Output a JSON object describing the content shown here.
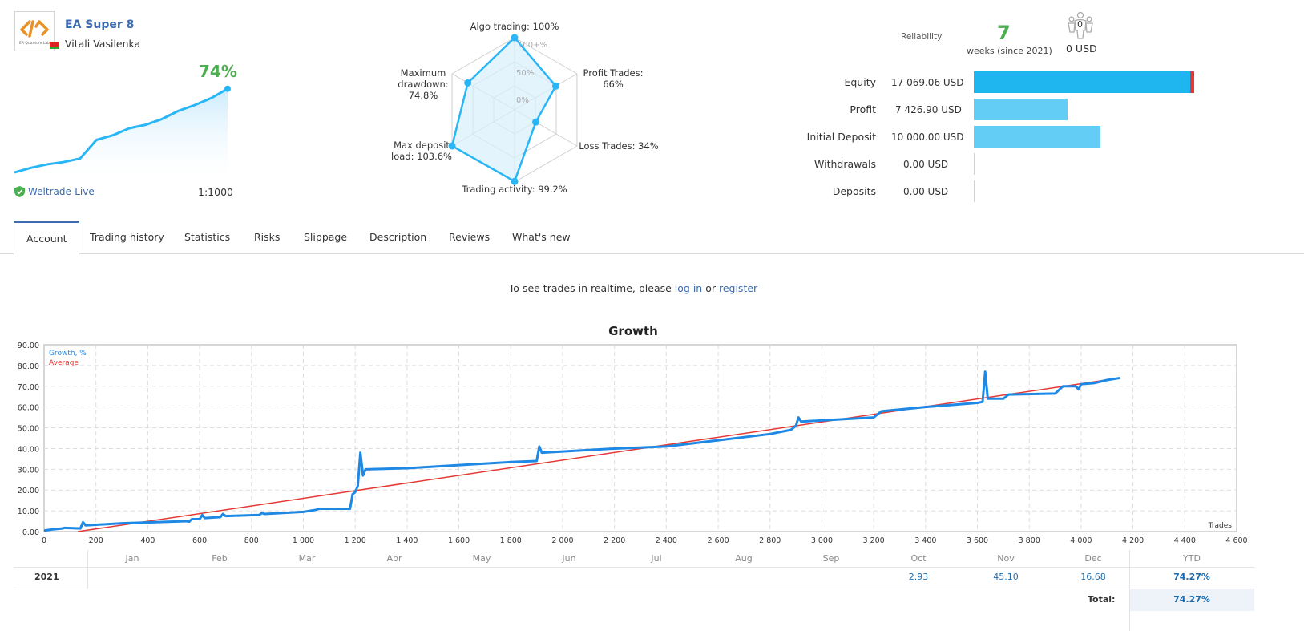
{
  "header": {
    "title": "EA Super 8",
    "author": "Vitali Vasilenka",
    "logo_text": "ER Quantum Lab",
    "growth_pct": "74%",
    "server": "Weltrade-Live",
    "leverage": "1:1000",
    "mini_chart_values": [
      2,
      6,
      9,
      11,
      14,
      30,
      34,
      40,
      43,
      48,
      55,
      60,
      66,
      74
    ]
  },
  "radar": {
    "axes": [
      {
        "label": "Algo trading: 100%",
        "value": 100
      },
      {
        "label": "Profit Trades:\n66%",
        "value": 66
      },
      {
        "label": "Loss Trades: 34%",
        "value": 34
      },
      {
        "label": "Trading activity: 99.2%",
        "value": 99.2
      },
      {
        "label": "Max deposit\nload: 103.6%",
        "value": 100
      },
      {
        "label": "Maximum\ndrawdown:\n74.8%",
        "value": 74.8
      }
    ],
    "scale_labels": [
      "100+%",
      "50%",
      "0%"
    ]
  },
  "stats": {
    "reliability_label": "Reliability",
    "weeks_value": "7",
    "weeks_label": "weeks (since 2021)",
    "subscribers_count": "0",
    "subscribers_usd": "0 USD",
    "rows": [
      {
        "label": "Equity",
        "value": "17 069.06 USD",
        "amount": 17069.06,
        "color": "#1fb5ef"
      },
      {
        "label": "Profit",
        "value": "7 426.90 USD",
        "amount": 7426.9,
        "color": "#64cdf5"
      },
      {
        "label": "Initial Deposit",
        "value": "10 000.00 USD",
        "amount": 10000.0,
        "color": "#64cdf5"
      },
      {
        "label": "Withdrawals",
        "value": "0.00 USD",
        "amount": 0,
        "color": "#a9dff5"
      },
      {
        "label": "Deposits",
        "value": "0.00 USD",
        "amount": 0,
        "color": "#a9dff5"
      }
    ]
  },
  "tabs": [
    {
      "label": "Account",
      "active": true
    },
    {
      "label": "Trading history"
    },
    {
      "label": "Statistics"
    },
    {
      "label": "Risks"
    },
    {
      "label": "Slippage"
    },
    {
      "label": "Description"
    },
    {
      "label": "Reviews"
    },
    {
      "label": "What's new"
    }
  ],
  "message": {
    "prefix": "To see trades in realtime, please ",
    "login": "log in",
    "middle": " or ",
    "register": "register"
  },
  "chart_data": {
    "type": "line",
    "title": "Growth",
    "xlabel": "Trades",
    "ylabel": "",
    "xlim": [
      0,
      4600
    ],
    "ylim": [
      0,
      90
    ],
    "grid": true,
    "legend_position": "top-left",
    "x_ticks": [
      "0",
      "200",
      "400",
      "600",
      "800",
      "1 000",
      "1 200",
      "1 400",
      "1 600",
      "1 800",
      "2 000",
      "2 200",
      "2 400",
      "2 600",
      "2 800",
      "3 000",
      "3 200",
      "3 400",
      "3 600",
      "3 800",
      "4 000",
      "4 200",
      "4 400",
      "4 600"
    ],
    "y_ticks": [
      "0.00",
      "10.00",
      "20.00",
      "30.00",
      "40.00",
      "50.00",
      "60.00",
      "70.00",
      "80.00",
      "90.00"
    ],
    "series": [
      {
        "name": "Growth, %",
        "color": "#1e88e5",
        "points": [
          [
            0,
            0.5
          ],
          [
            30,
            1
          ],
          [
            70,
            1.5
          ],
          [
            80,
            1.8
          ],
          [
            140,
            1.5
          ],
          [
            150,
            4.5
          ],
          [
            160,
            3
          ],
          [
            300,
            4
          ],
          [
            550,
            5
          ],
          [
            560,
            4.8
          ],
          [
            570,
            6
          ],
          [
            600,
            6
          ],
          [
            610,
            8
          ],
          [
            620,
            6.5
          ],
          [
            680,
            7
          ],
          [
            690,
            8.5
          ],
          [
            700,
            7.5
          ],
          [
            830,
            8
          ],
          [
            840,
            9
          ],
          [
            850,
            8.5
          ],
          [
            1000,
            9.5
          ],
          [
            1050,
            10.5
          ],
          [
            1060,
            11
          ],
          [
            1180,
            11
          ],
          [
            1190,
            18
          ],
          [
            1200,
            19
          ],
          [
            1210,
            22
          ],
          [
            1220,
            38
          ],
          [
            1230,
            27
          ],
          [
            1240,
            30
          ],
          [
            1400,
            30.5
          ],
          [
            1600,
            32
          ],
          [
            1800,
            33.5
          ],
          [
            1900,
            34
          ],
          [
            1910,
            41
          ],
          [
            1920,
            38
          ],
          [
            2200,
            40
          ],
          [
            2400,
            41
          ],
          [
            2600,
            44
          ],
          [
            2800,
            47
          ],
          [
            2880,
            49
          ],
          [
            2900,
            51
          ],
          [
            2910,
            55
          ],
          [
            2920,
            53
          ],
          [
            3200,
            55
          ],
          [
            3230,
            58
          ],
          [
            3400,
            60
          ],
          [
            3600,
            62
          ],
          [
            3620,
            62.5
          ],
          [
            3630,
            77
          ],
          [
            3640,
            64
          ],
          [
            3700,
            64
          ],
          [
            3720,
            66
          ],
          [
            3900,
            66.5
          ],
          [
            3930,
            70
          ],
          [
            3980,
            70
          ],
          [
            3990,
            68.5
          ],
          [
            4000,
            71
          ],
          [
            4050,
            71.5
          ],
          [
            4100,
            73
          ],
          [
            4150,
            74
          ]
        ]
      },
      {
        "name": "Average",
        "color": "#e53935",
        "points": [
          [
            130,
            0
          ],
          [
            4150,
            74
          ]
        ]
      }
    ],
    "monthly_table": {
      "months": [
        "Jan",
        "Feb",
        "Mar",
        "Apr",
        "May",
        "Jun",
        "Jul",
        "Aug",
        "Sep",
        "Oct",
        "Nov",
        "Dec"
      ],
      "ytd_label": "YTD",
      "rows": [
        {
          "year": "2021",
          "values": [
            "",
            "",
            "",
            "",
            "",
            "",
            "",
            "",
            "",
            "2.93",
            "45.10",
            "16.68"
          ],
          "ytd": "74.27%"
        }
      ],
      "total_label": "Total:",
      "total_value": "74.27%"
    }
  }
}
